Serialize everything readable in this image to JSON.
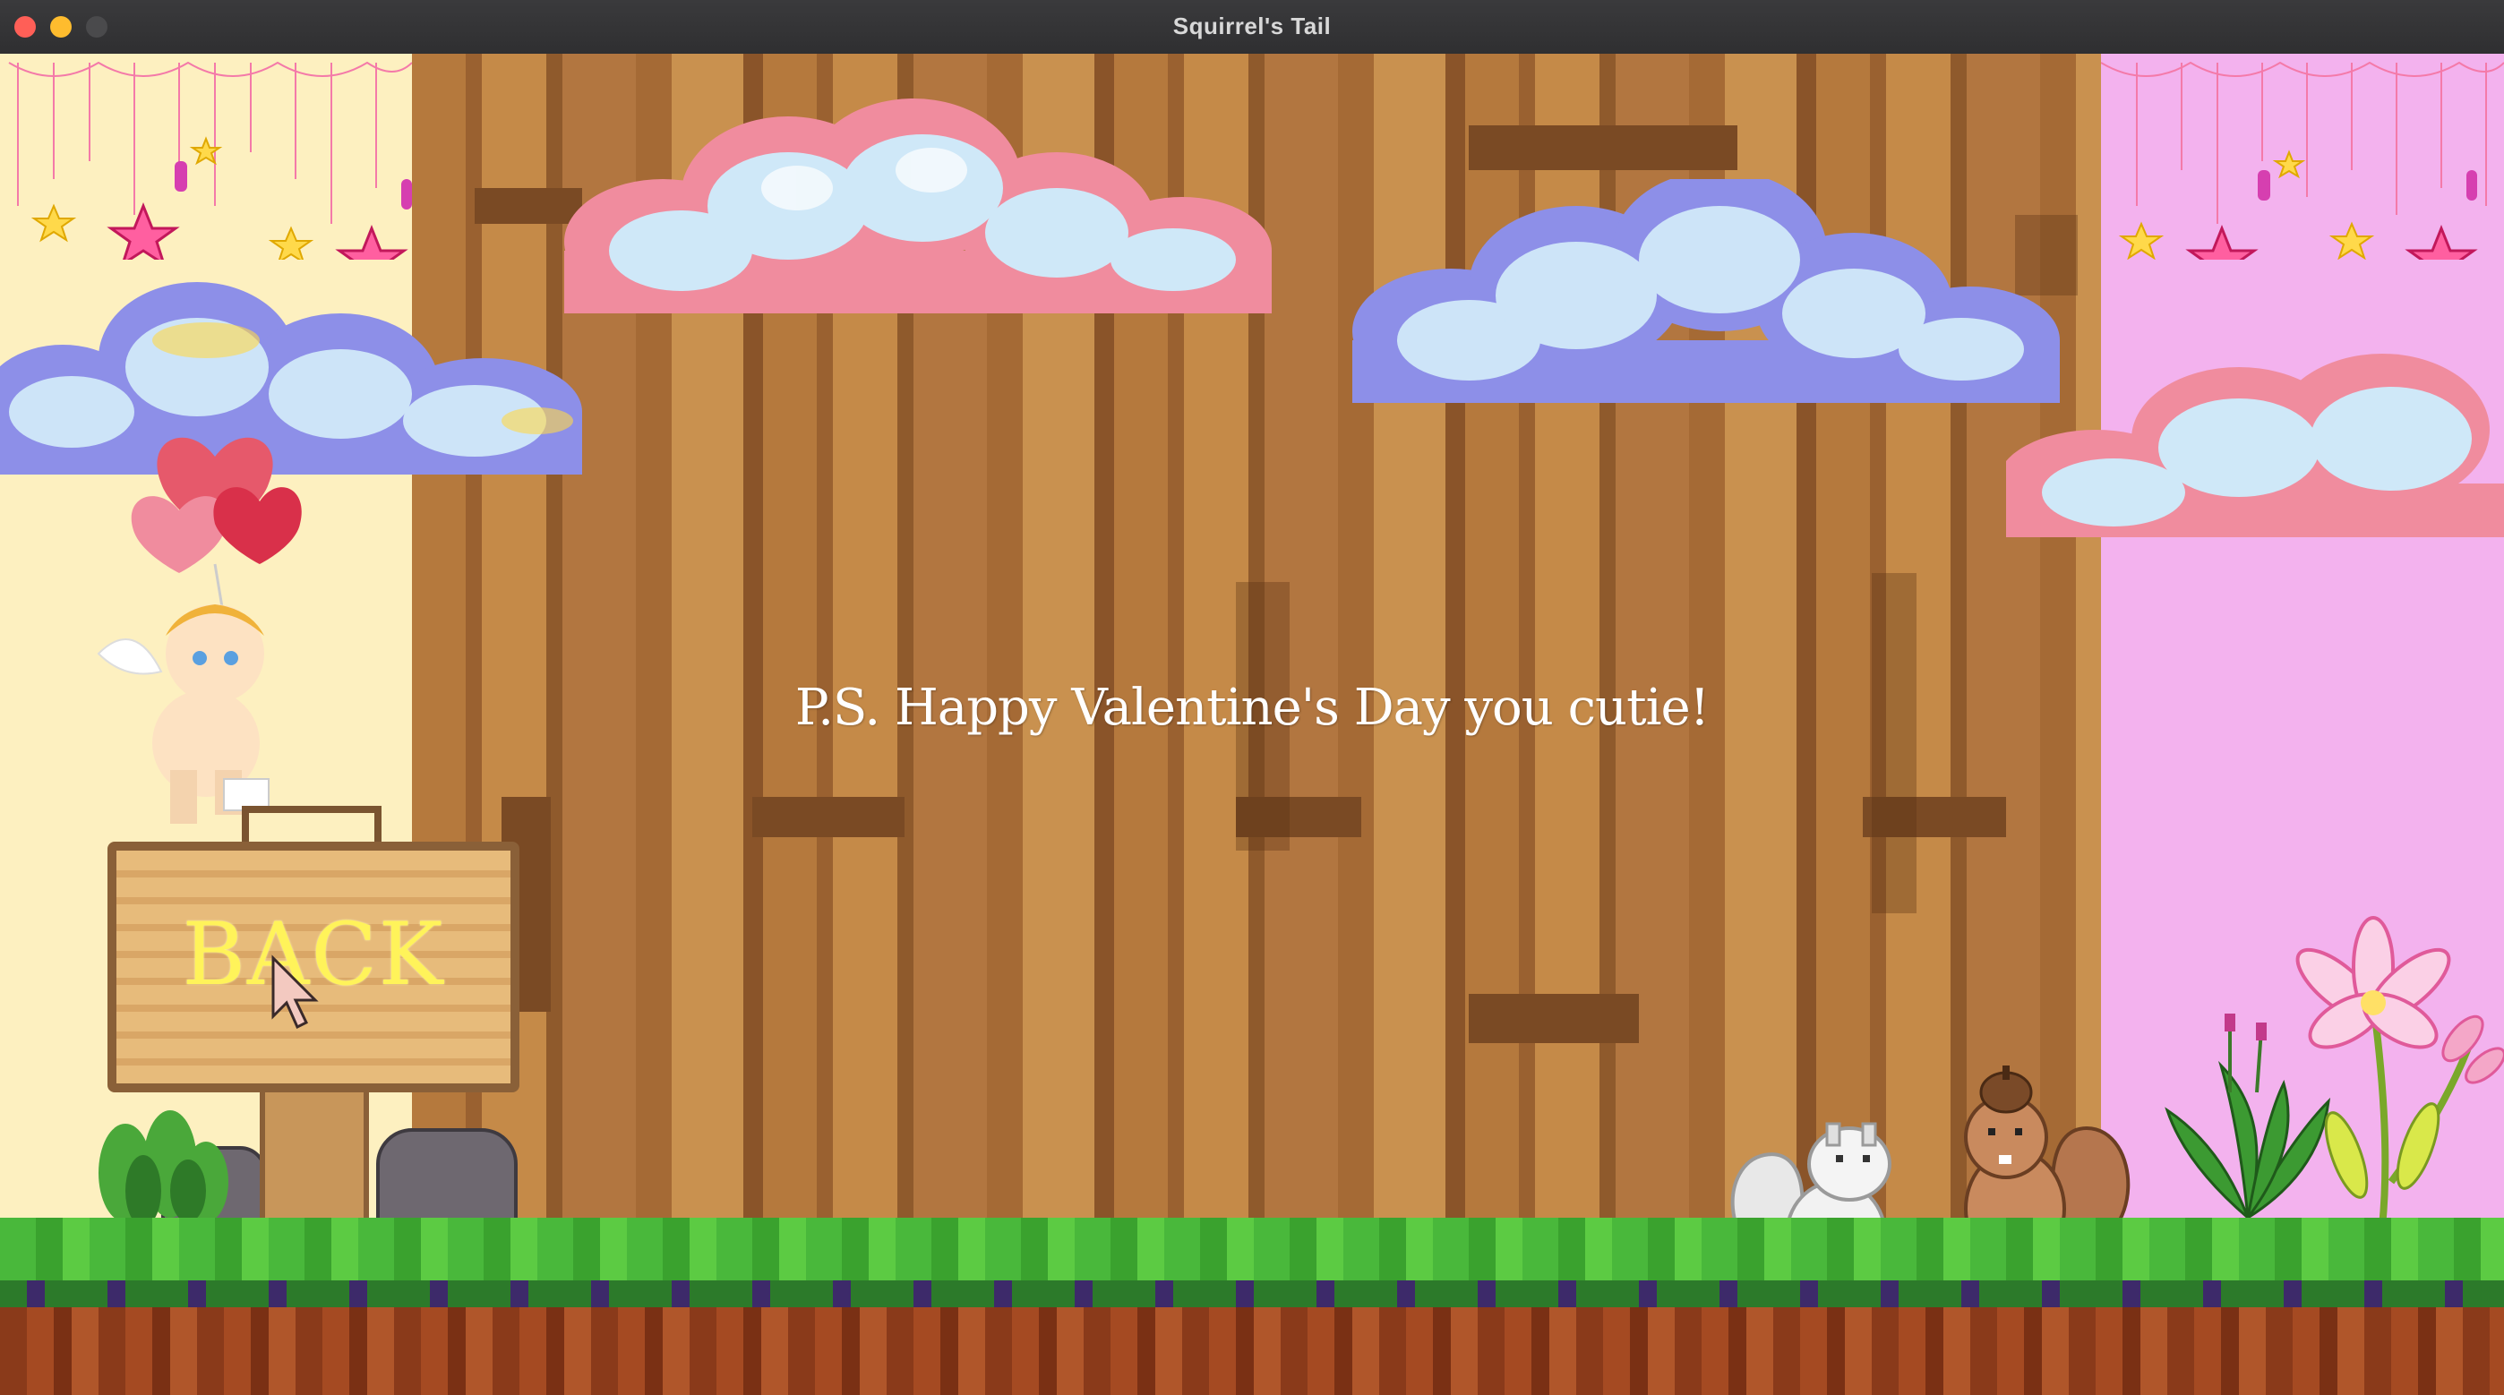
{
  "window": {
    "title": "Squirrel's Tail"
  },
  "game": {
    "message": "P.S. Happy Valentine's Day you cutie!",
    "back_button_label": "BACK"
  },
  "icons": {
    "cursor": "arrow-cursor-icon",
    "cupid": "cupid-icon",
    "hearts": "heart-balloons-icon",
    "white_squirrel": "white-squirrel-icon",
    "brown_squirrel": "brown-squirrel-icon",
    "lily": "lily-flower-icon"
  },
  "colors": {
    "left_panel": "#fdf0c0",
    "right_panel": "#f3b2ee",
    "message_text": "#ffffff",
    "back_text": "#fff35a"
  }
}
